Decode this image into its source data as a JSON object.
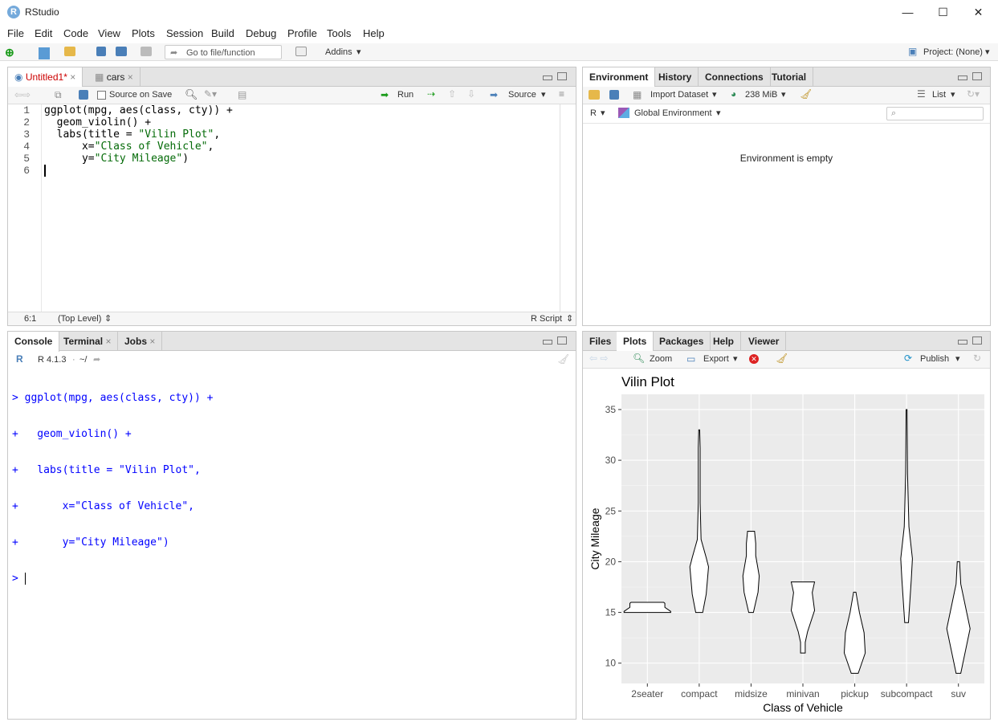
{
  "window": {
    "title": "RStudio",
    "min": "—",
    "max": "☐",
    "close": "✕"
  },
  "menu": [
    "File",
    "Edit",
    "Code",
    "View",
    "Plots",
    "Session",
    "Build",
    "Debug",
    "Profile",
    "Tools",
    "Help"
  ],
  "toolbar": {
    "goto_placeholder": "Go to file/function",
    "addins": "Addins",
    "project": "Project: (None)"
  },
  "editor": {
    "tabs": [
      "Untitled1*",
      "cars"
    ],
    "source_on_save": "Source on Save",
    "run": "Run",
    "source": "Source",
    "lines": [
      "1",
      "2",
      "3",
      "4",
      "5",
      "6"
    ],
    "status_pos": "6:1",
    "status_scope": "(Top Level)",
    "status_type": "R Script"
  },
  "console": {
    "tabs": [
      "Console",
      "Terminal",
      "Jobs"
    ],
    "version": "R 4.1.3",
    "path": "~/",
    "lines": [
      "> ggplot(mpg, aes(class, cty)) +",
      "+   geom_violin() +",
      "+   labs(title = \"Vilin Plot\",",
      "+       x=\"Class of Vehicle\",",
      "+       y=\"City Mileage\")",
      "> "
    ]
  },
  "env": {
    "tabs": [
      "Environment",
      "History",
      "Connections",
      "Tutorial"
    ],
    "import": "Import Dataset",
    "mem": "238 MiB",
    "list": "List",
    "lang": "R",
    "scope": "Global Environment",
    "empty": "Environment is empty"
  },
  "plots": {
    "tabs": [
      "Files",
      "Plots",
      "Packages",
      "Help",
      "Viewer"
    ],
    "zoom": "Zoom",
    "export": "Export",
    "publish": "Publish"
  },
  "chart_data": {
    "type": "violin",
    "title": "Vilin Plot",
    "xlabel": "Class of Vehicle",
    "ylabel": "City Mileage",
    "categories": [
      "2seater",
      "compact",
      "midsize",
      "minivan",
      "pickup",
      "subcompact",
      "suv"
    ],
    "ranges": [
      [
        15,
        16
      ],
      [
        15,
        33
      ],
      [
        15,
        23
      ],
      [
        11,
        18
      ],
      [
        9,
        17
      ],
      [
        14,
        35
      ],
      [
        9,
        20
      ]
    ],
    "yticks": [
      10,
      15,
      20,
      25,
      30,
      35
    ],
    "ylim": [
      8,
      36.5
    ],
    "grid": true
  }
}
